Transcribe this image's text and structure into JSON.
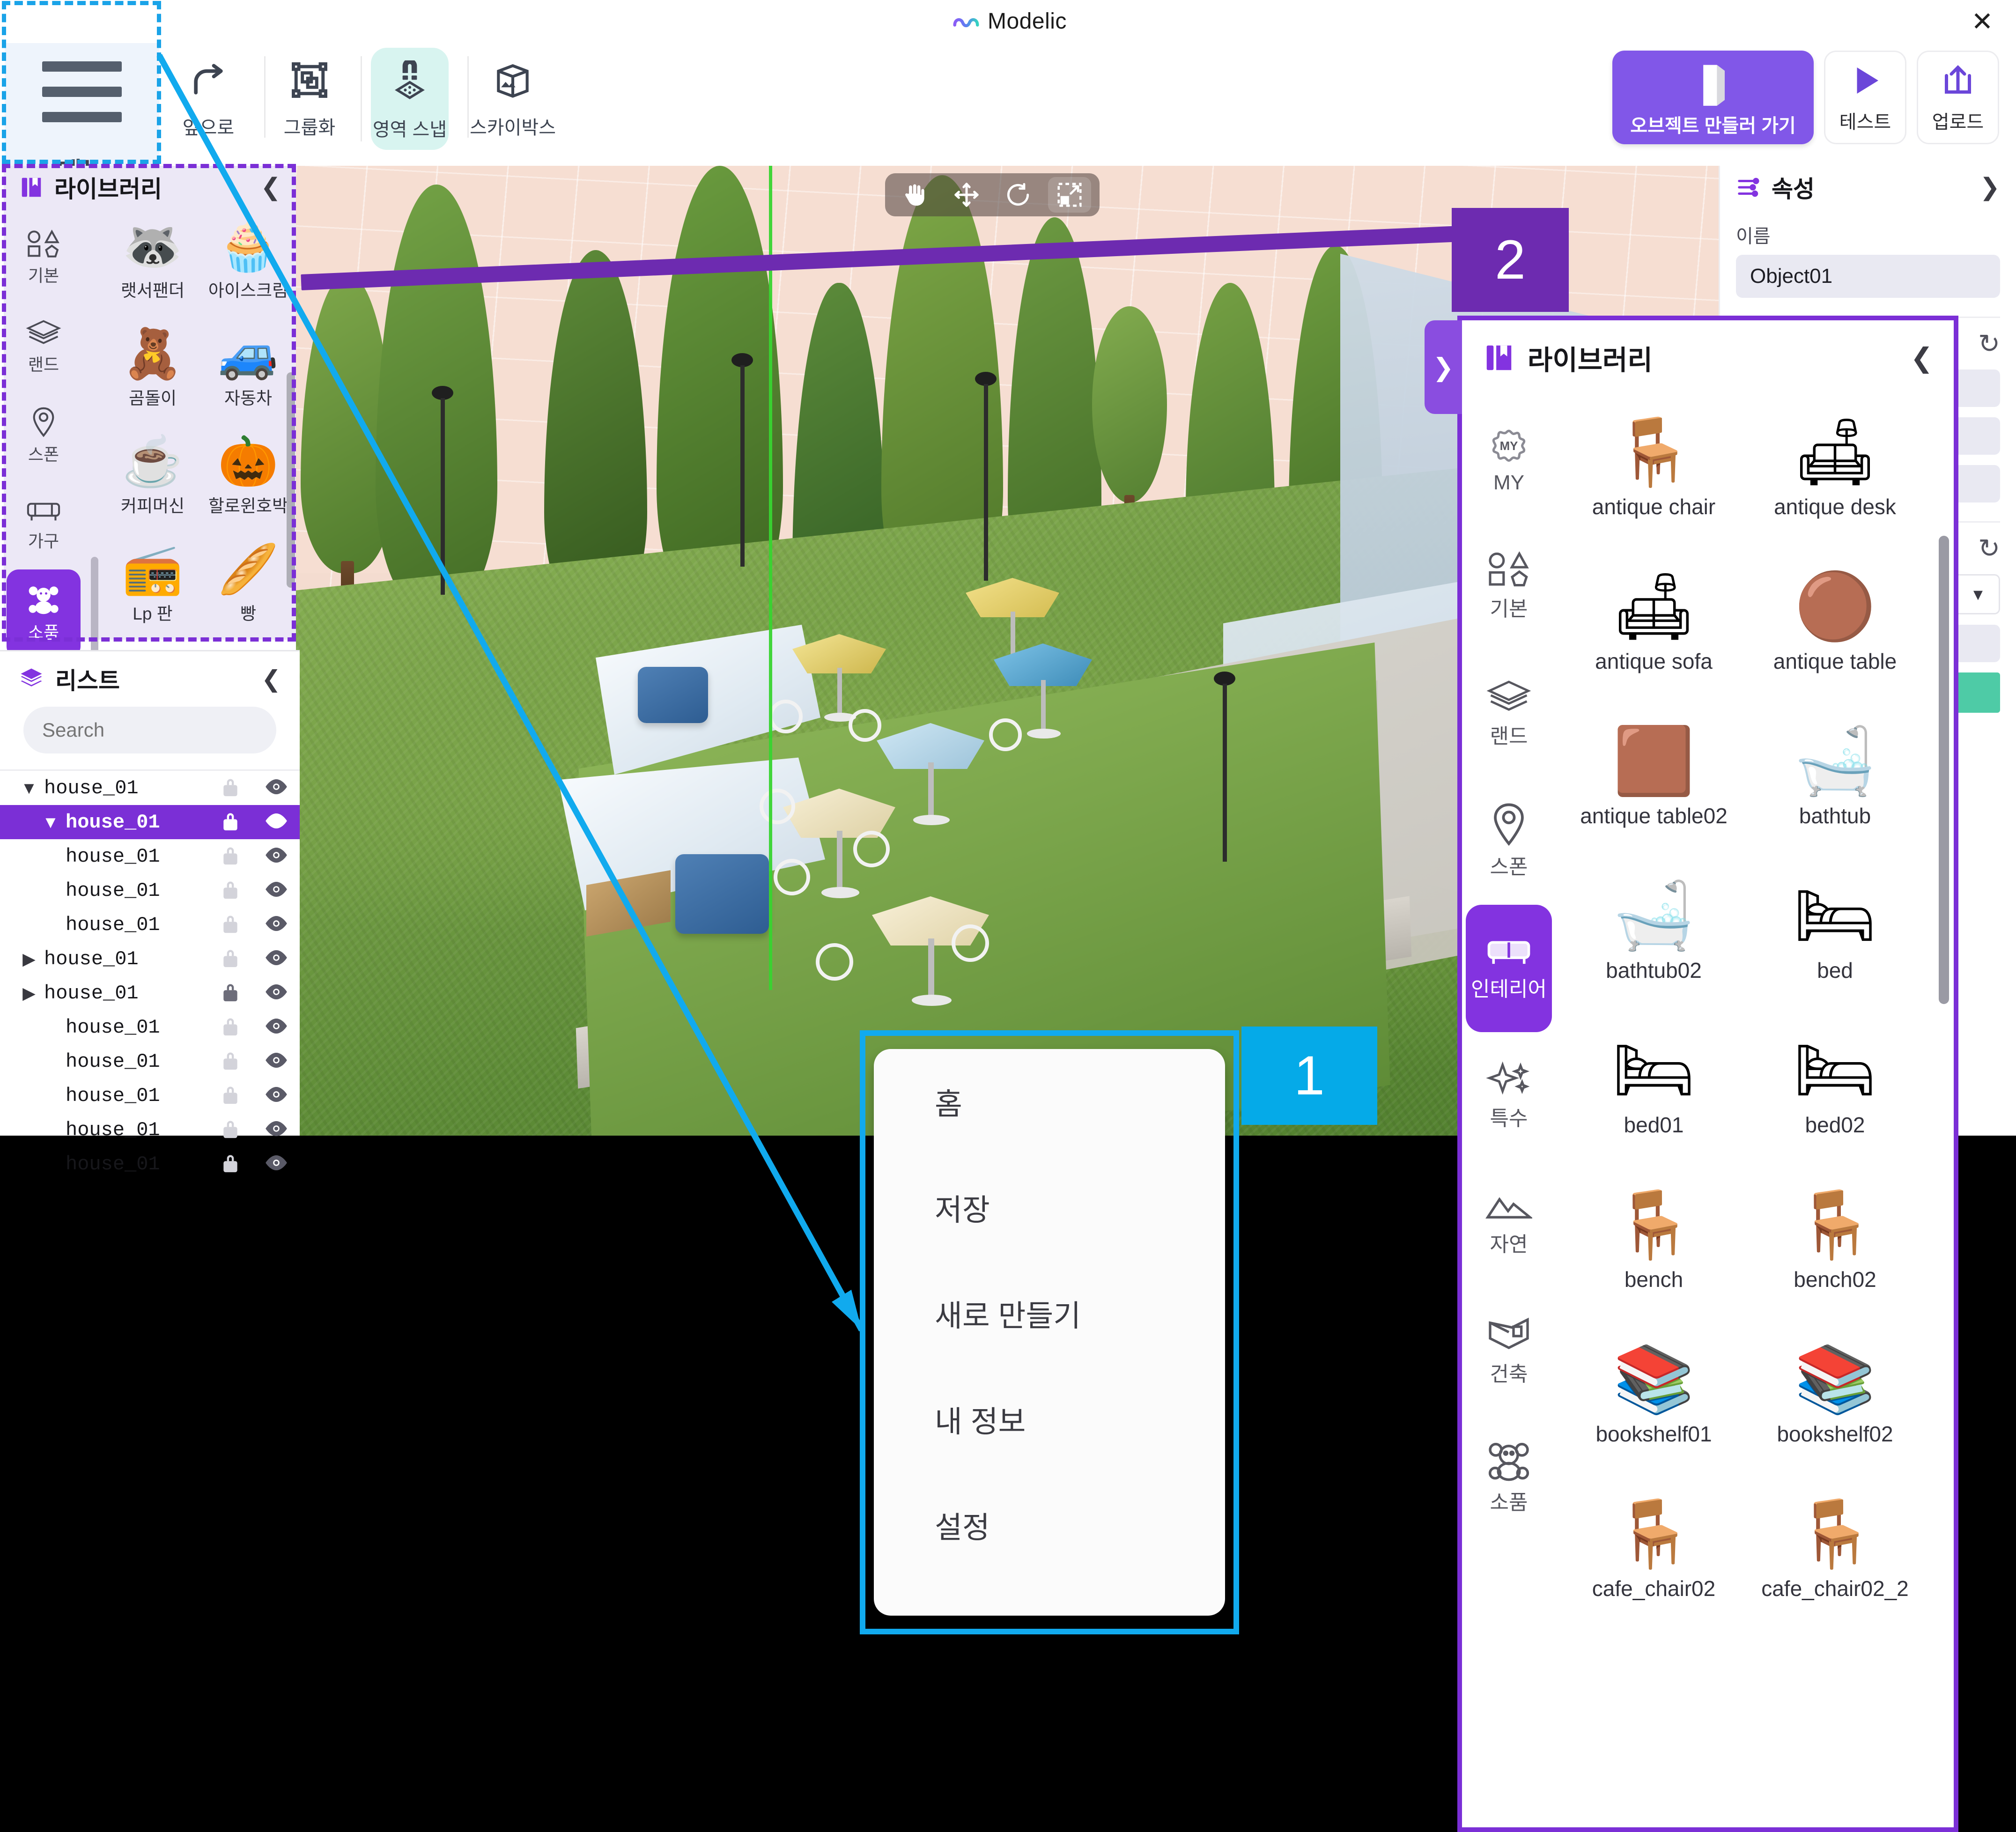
{
  "window": {
    "title": "Modelic",
    "close_label": "✕"
  },
  "toolbar": {
    "menu_label": "메뉴",
    "tools": [
      {
        "label": "앞으로",
        "icon": "redo-arrow-icon",
        "active": false
      },
      {
        "label": "그룹화",
        "icon": "group-objects-icon",
        "active": false
      },
      {
        "label": "영역 스냅",
        "icon": "magnet-snap-icon",
        "active": true
      },
      {
        "label": "스카이박스",
        "icon": "skybox-cube-icon",
        "active": false
      }
    ],
    "cta_label": "오브젝트 만들러 가기",
    "cta_icon": "white-box-icon",
    "test_label": "테스트",
    "test_icon": "play-icon",
    "upload_label": "업로드",
    "upload_icon": "upload-tray-icon"
  },
  "viewport": {
    "tools": [
      {
        "name": "pan-hand-tool",
        "glyph": "✋",
        "active": false
      },
      {
        "name": "move-tool",
        "glyph": "✥",
        "active": false
      },
      {
        "name": "rotate-tool",
        "glyph": "↺",
        "active": false
      },
      {
        "name": "scale-tool",
        "glyph": "⬓",
        "active": true
      }
    ],
    "axis_widget": "view-axis-gizmo"
  },
  "library_left": {
    "title": "라이브러리",
    "icon": "book-icon",
    "collapse_glyph": "❮",
    "categories": [
      {
        "label": "기본",
        "icon": "basic-shapes-icon",
        "selected": false
      },
      {
        "label": "랜드",
        "icon": "land-layers-icon",
        "selected": false
      },
      {
        "label": "스폰",
        "icon": "spawn-pin-icon",
        "selected": false
      },
      {
        "label": "가구",
        "icon": "furniture-sofa-icon",
        "selected": false
      },
      {
        "label": "소품",
        "icon": "prop-bear-icon",
        "selected": true
      }
    ],
    "items": [
      {
        "name": "랫서팬더",
        "glyph": "🦝"
      },
      {
        "name": "아이스크림",
        "glyph": "🧁"
      },
      {
        "name": "곰돌이",
        "glyph": "🧸"
      },
      {
        "name": "자동차",
        "glyph": "🚙"
      },
      {
        "name": "커피머신",
        "glyph": "☕"
      },
      {
        "name": "할로윈호박",
        "glyph": "🎃"
      },
      {
        "name": "Lp 판",
        "glyph": "📻"
      },
      {
        "name": "빵",
        "glyph": "🥖"
      }
    ]
  },
  "list_panel": {
    "title": "리스트",
    "icon": "layers-icon",
    "collapse_glyph": "❮",
    "search": {
      "placeholder": "Search",
      "value": "",
      "icon": "search-icon"
    },
    "rows": [
      {
        "name": "house_01",
        "indent": 0,
        "twisty": "▼",
        "selected": false,
        "locked": false,
        "visible": true
      },
      {
        "name": "house_01",
        "indent": 1,
        "twisty": "▼",
        "selected": true,
        "locked": true,
        "visible": true
      },
      {
        "name": "house_01",
        "indent": 1,
        "twisty": "",
        "selected": false,
        "locked": false,
        "visible": true
      },
      {
        "name": "house_01",
        "indent": 1,
        "twisty": "",
        "selected": false,
        "locked": false,
        "visible": true
      },
      {
        "name": "house_01",
        "indent": 1,
        "twisty": "",
        "selected": false,
        "locked": false,
        "visible": true
      },
      {
        "name": "house_01",
        "indent": 0,
        "twisty": "▶",
        "selected": false,
        "locked": false,
        "visible": true
      },
      {
        "name": "house_01",
        "indent": 0,
        "twisty": "▶",
        "selected": false,
        "locked": true,
        "visible": true
      },
      {
        "name": "house_01",
        "indent": 1,
        "twisty": "",
        "selected": false,
        "locked": false,
        "visible": true
      },
      {
        "name": "house_01",
        "indent": 1,
        "twisty": "",
        "selected": false,
        "locked": false,
        "visible": true
      },
      {
        "name": "house_01",
        "indent": 1,
        "twisty": "",
        "selected": false,
        "locked": false,
        "visible": true
      },
      {
        "name": "house_01",
        "indent": 1,
        "twisty": "",
        "selected": false,
        "locked": false,
        "visible": true
      },
      {
        "name": "house_01",
        "indent": 1,
        "twisty": "",
        "selected": false,
        "locked": false,
        "visible": true
      }
    ]
  },
  "properties": {
    "title": "속성",
    "icon": "sliders-icon",
    "collapse_glyph": "❯",
    "name_label": "이름",
    "name_value": "Object01",
    "reset_glyph": "↻",
    "accent_color": "#8157e8",
    "swatch_color": "#4ecba6"
  },
  "library_right": {
    "title": "라이브러리",
    "icon": "book-icon",
    "collapse_glyph": "❮",
    "expand_glyph": "❯",
    "categories": [
      {
        "label": "MY",
        "icon": "my-badge-icon",
        "selected": false
      },
      {
        "label": "기본",
        "icon": "basic-shapes-icon",
        "selected": false
      },
      {
        "label": "랜드",
        "icon": "land-layers-icon",
        "selected": false
      },
      {
        "label": "스폰",
        "icon": "spawn-pin-icon",
        "selected": false
      },
      {
        "label": "인테리어",
        "icon": "interior-sofa-icon",
        "selected": true
      },
      {
        "label": "특수",
        "icon": "sparkle-icon",
        "selected": false
      },
      {
        "label": "자연",
        "icon": "mountain-icon",
        "selected": false
      },
      {
        "label": "건축",
        "icon": "architecture-room-icon",
        "selected": false
      },
      {
        "label": "소품",
        "icon": "prop-bear-icon",
        "selected": false
      }
    ],
    "items": [
      {
        "name": "antique chair",
        "glyph": "🪑"
      },
      {
        "name": "antique desk",
        "glyph": "🛋"
      },
      {
        "name": "antique sofa",
        "glyph": "🛋"
      },
      {
        "name": "antique table",
        "glyph": "🟤"
      },
      {
        "name": "antique table02",
        "glyph": "🟫"
      },
      {
        "name": "bathtub",
        "glyph": "🛁"
      },
      {
        "name": "bathtub02",
        "glyph": "🛁"
      },
      {
        "name": "bed",
        "glyph": "🛏"
      },
      {
        "name": "bed01",
        "glyph": "🛏"
      },
      {
        "name": "bed02",
        "glyph": "🛏"
      },
      {
        "name": "bench",
        "glyph": "🪑"
      },
      {
        "name": "bench02",
        "glyph": "🪑"
      },
      {
        "name": "bookshelf01",
        "glyph": "📚"
      },
      {
        "name": "bookshelf02",
        "glyph": "📚"
      },
      {
        "name": "cafe_chair02",
        "glyph": "🪑"
      },
      {
        "name": "cafe_chair02_2",
        "glyph": "🪑"
      }
    ]
  },
  "menu_popup": {
    "items": [
      {
        "label": "홈"
      },
      {
        "label": "저장"
      },
      {
        "label": "새로 만들기"
      },
      {
        "label": "내 정보"
      },
      {
        "label": "설정"
      }
    ]
  },
  "callouts": {
    "step1": "1",
    "step2": "2",
    "step1_color": "#05aae8",
    "step2_color": "#6d2bb0"
  }
}
